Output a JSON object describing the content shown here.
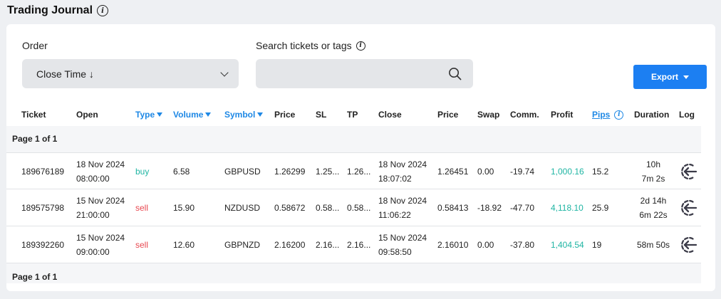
{
  "page": {
    "title": "Trading Journal"
  },
  "filters": {
    "order_label": "Order",
    "order_value": "Close Time ↓",
    "search_label": "Search tickets or tags",
    "search_value": "",
    "search_placeholder": ""
  },
  "toolbar": {
    "export_label": "Export"
  },
  "table": {
    "headers": {
      "ticket": "Ticket",
      "open": "Open",
      "type": "Type",
      "volume": "Volume",
      "symbol": "Symbol",
      "price_open": "Price",
      "sl": "SL",
      "tp": "TP",
      "close": "Close",
      "price_close": "Price",
      "swap": "Swap",
      "comm": "Comm.",
      "profit": "Profit",
      "pips": "Pips",
      "duration": "Duration",
      "log": "Log"
    },
    "pager_top": "Page 1 of 1",
    "pager_bottom": "Page 1 of 1",
    "rows": [
      {
        "ticket": "189676189",
        "open_date": "18 Nov 2024",
        "open_time": "08:00:00",
        "type": "buy",
        "volume": "6.58",
        "symbol": "GBPUSD",
        "price_open": "1.26299",
        "sl": "1.25...",
        "tp": "1.26...",
        "close_date": "18 Nov 2024",
        "close_time": "18:07:02",
        "price_close": "1.26451",
        "swap": "0.00",
        "comm": "-19.74",
        "profit": "1,000.16",
        "pips": "15.2",
        "duration_1": "10h",
        "duration_2": "7m 2s"
      },
      {
        "ticket": "189575798",
        "open_date": "15 Nov 2024",
        "open_time": "21:00:00",
        "type": "sell",
        "volume": "15.90",
        "symbol": "NZDUSD",
        "price_open": "0.58672",
        "sl": "0.58...",
        "tp": "0.58...",
        "close_date": "18 Nov 2024",
        "close_time": "11:06:22",
        "price_close": "0.58413",
        "swap": "-18.92",
        "comm": "-47.70",
        "profit": "4,118.10",
        "pips": "25.9",
        "duration_1": "2d 14h",
        "duration_2": "6m 22s"
      },
      {
        "ticket": "189392260",
        "open_date": "15 Nov 2024",
        "open_time": "09:00:00",
        "type": "sell",
        "volume": "12.60",
        "symbol": "GBPNZD",
        "price_open": "2.16200",
        "sl": "2.16...",
        "tp": "2.16...",
        "close_date": "15 Nov 2024",
        "close_time": "09:58:50",
        "price_close": "2.16010",
        "swap": "0.00",
        "comm": "-37.80",
        "profit": "1,404.54",
        "pips": "19",
        "duration_1": "58m 50s",
        "duration_2": ""
      }
    ]
  },
  "colors": {
    "accent": "#1c7ff2",
    "buy": "#1fb5a3",
    "sell": "#e8474f",
    "profit": "#1fb5a3"
  },
  "icons": {
    "title_info": "info-icon",
    "search": "search-icon",
    "select": "chevron-down-icon",
    "log": "log-return-icon"
  }
}
